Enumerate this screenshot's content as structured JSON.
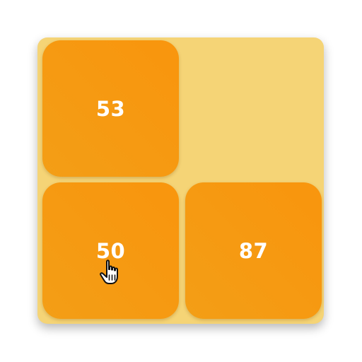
{
  "colors": {
    "board_background": "#F5D476",
    "tile_gradient_start": "#F39E16",
    "tile_gradient_end": "#F9950D",
    "tile_text": "#FFFFFF"
  },
  "board": {
    "grid": "2x2",
    "tiles": [
      {
        "value": "53",
        "row": 1,
        "col": 1
      },
      {
        "value": "50",
        "row": 2,
        "col": 1
      },
      {
        "value": "87",
        "row": 2,
        "col": 2
      }
    ],
    "empty_cells": [
      {
        "row": 1,
        "col": 2
      }
    ]
  },
  "cursor": {
    "icon": "hand-pointer-icon",
    "over_tile": "50"
  }
}
